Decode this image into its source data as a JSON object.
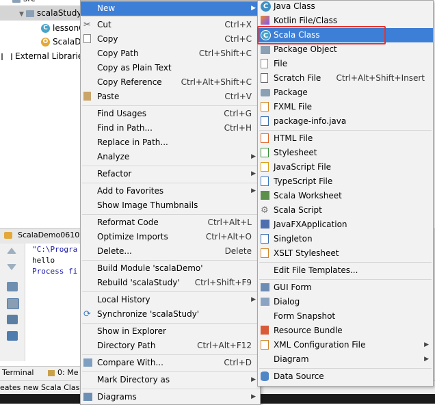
{
  "project_tree": {
    "items": [
      {
        "label": "src"
      },
      {
        "label": "scalaStudy"
      },
      {
        "label": "lessonO"
      },
      {
        "label": "ScalaD"
      },
      {
        "label": "External Libraries"
      }
    ]
  },
  "run_panel": {
    "tab_label": "ScalaDemo0610",
    "console_lines": [
      "\"C:\\Progra",
      "hello",
      "Process fi"
    ]
  },
  "bottom_tabs": {
    "terminal": "Terminal",
    "messages": "0: Me"
  },
  "status_bar": {
    "text": "eates new Scala Clas"
  },
  "context_menu": {
    "items": [
      {
        "label": "New",
        "shortcut": "",
        "submenu": true,
        "selected": true
      },
      {
        "label": "Cut",
        "shortcut": "Ctrl+X",
        "icon": "scissors-icon"
      },
      {
        "label": "Copy",
        "shortcut": "Ctrl+C",
        "icon": "copy-icon"
      },
      {
        "label": "Copy Path",
        "shortcut": "Ctrl+Shift+C"
      },
      {
        "label": "Copy as Plain Text",
        "shortcut": ""
      },
      {
        "label": "Copy Reference",
        "shortcut": "Ctrl+Alt+Shift+C"
      },
      {
        "label": "Paste",
        "shortcut": "Ctrl+V",
        "icon": "paste-icon"
      },
      {
        "label": "Find Usages",
        "shortcut": "Ctrl+G"
      },
      {
        "label": "Find in Path...",
        "shortcut": "Ctrl+H"
      },
      {
        "label": "Replace in Path...",
        "shortcut": ""
      },
      {
        "label": "Analyze",
        "shortcut": "",
        "submenu": true
      },
      {
        "label": "Refactor",
        "shortcut": "",
        "submenu": true
      },
      {
        "label": "Add to Favorites",
        "shortcut": "",
        "submenu": true
      },
      {
        "label": "Show Image Thumbnails",
        "shortcut": ""
      },
      {
        "label": "Reformat Code",
        "shortcut": "Ctrl+Alt+L"
      },
      {
        "label": "Optimize Imports",
        "shortcut": "Ctrl+Alt+O"
      },
      {
        "label": "Delete...",
        "shortcut": "Delete"
      },
      {
        "label": "Build Module 'scalaDemo'",
        "shortcut": ""
      },
      {
        "label": "Rebuild 'scalaStudy'",
        "shortcut": "Ctrl+Shift+F9"
      },
      {
        "label": "Local History",
        "shortcut": "",
        "submenu": true
      },
      {
        "label": "Synchronize 'scalaStudy'",
        "shortcut": "",
        "icon": "sync-icon"
      },
      {
        "label": "Show in Explorer",
        "shortcut": ""
      },
      {
        "label": "Directory Path",
        "shortcut": "Ctrl+Alt+F12"
      },
      {
        "label": "Compare With...",
        "shortcut": "Ctrl+D",
        "icon": "compare-icon"
      },
      {
        "label": "Mark Directory as",
        "shortcut": "",
        "submenu": true
      },
      {
        "label": "Diagrams",
        "shortcut": "",
        "submenu": true,
        "icon": "diagram-icon"
      }
    ]
  },
  "new_submenu": {
    "items": [
      {
        "label": "Java Class",
        "shortcut": "",
        "icon": "java-class-icon"
      },
      {
        "label": "Kotlin File/Class",
        "shortcut": "",
        "icon": "kotlin-icon"
      },
      {
        "label": "Scala Class",
        "shortcut": "",
        "icon": "scala-class-icon",
        "selected": true
      },
      {
        "label": "Package Object",
        "shortcut": "",
        "icon": "package-object-icon"
      },
      {
        "label": "File",
        "shortcut": "",
        "icon": "file-icon"
      },
      {
        "label": "Scratch File",
        "shortcut": "Ctrl+Alt+Shift+Insert",
        "icon": "scratch-file-icon"
      },
      {
        "label": "Package",
        "shortcut": "",
        "icon": "package-icon"
      },
      {
        "label": "FXML File",
        "shortcut": "",
        "icon": "fxml-file-icon"
      },
      {
        "label": "package-info.java",
        "shortcut": "",
        "icon": "java-file-icon"
      },
      {
        "label": "HTML File",
        "shortcut": "",
        "icon": "html-file-icon"
      },
      {
        "label": "Stylesheet",
        "shortcut": "",
        "icon": "css-file-icon"
      },
      {
        "label": "JavaScript File",
        "shortcut": "",
        "icon": "js-file-icon"
      },
      {
        "label": "TypeScript File",
        "shortcut": "",
        "icon": "ts-file-icon"
      },
      {
        "label": "Scala Worksheet",
        "shortcut": "",
        "icon": "worksheet-icon"
      },
      {
        "label": "Scala Script",
        "shortcut": "",
        "icon": "scala-script-icon"
      },
      {
        "label": "JavaFXApplication",
        "shortcut": "",
        "icon": "javafx-icon"
      },
      {
        "label": "Singleton",
        "shortcut": "",
        "icon": "singleton-icon"
      },
      {
        "label": "XSLT Stylesheet",
        "shortcut": "",
        "icon": "xslt-icon"
      },
      {
        "label": "Edit File Templates...",
        "shortcut": ""
      },
      {
        "label": "GUI Form",
        "shortcut": "",
        "icon": "gui-form-icon"
      },
      {
        "label": "Dialog",
        "shortcut": "",
        "icon": "dialog-icon"
      },
      {
        "label": "Form Snapshot",
        "shortcut": ""
      },
      {
        "label": "Resource Bundle",
        "shortcut": "",
        "icon": "resource-bundle-icon"
      },
      {
        "label": "XML Configuration File",
        "shortcut": "",
        "submenu": true,
        "icon": "xml-icon"
      },
      {
        "label": "Diagram",
        "shortcut": "",
        "submenu": true
      },
      {
        "label": "Data Source",
        "shortcut": "",
        "icon": "database-icon"
      }
    ]
  },
  "colors": {
    "selection": "#3d7fd6",
    "highlight_box": "#e8322b",
    "menu_bg": "#f2f2f2"
  }
}
